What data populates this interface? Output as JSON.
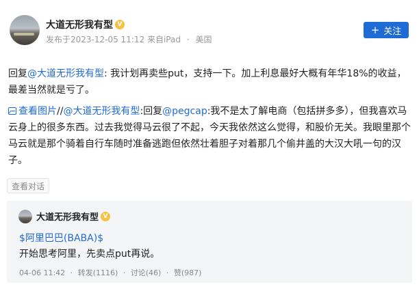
{
  "post": {
    "author": "大道无形我有型",
    "meta": {
      "published": "发布于2023-12-05 11:12",
      "source": "来自iPad",
      "location": "美国"
    },
    "follow_label": "关注",
    "paragraph1": {
      "prefix": "回复",
      "mention": "@大道无形我有型",
      "text": ": 我计划再卖些put，支持一下。加上利息最好大概有年华18%的收益，最差当然就是亏了。"
    },
    "paragraph2": {
      "image_link": "查看图片",
      "sep": "//",
      "mention1": "@大道无形我有型",
      "mid": ":回复",
      "mention2": "@pegcap",
      "text": ":我不是太了解电商（包括拼多多），但我喜欢马云身上的很多东西。过去我觉得马云很了不起，今天我依然这么觉得，和股价无关。我眼里那个马云就是那个骑着自行车随时准备逃跑但依然壮着胆子对着那几个偷井盖的大汉大吼一句的汉子。"
    },
    "view_conversation": "查看对话"
  },
  "quoted": {
    "author": "大道无形我有型",
    "stock": "$阿里巴巴(BABA)$",
    "text": "开始思考阿里，先卖点put再说。",
    "time": "04-06 11:42",
    "reposts": "转发(1116)",
    "comments": "讨论(46)",
    "likes": "赞(987)"
  },
  "colors": {
    "link": "#1f6bd6",
    "follow_button": "#1f6bd6",
    "quote_bg": "#f4f5f7"
  },
  "icons": {
    "vip": "vip-badge-icon",
    "image": "image-icon",
    "follow": "plus-icon"
  }
}
